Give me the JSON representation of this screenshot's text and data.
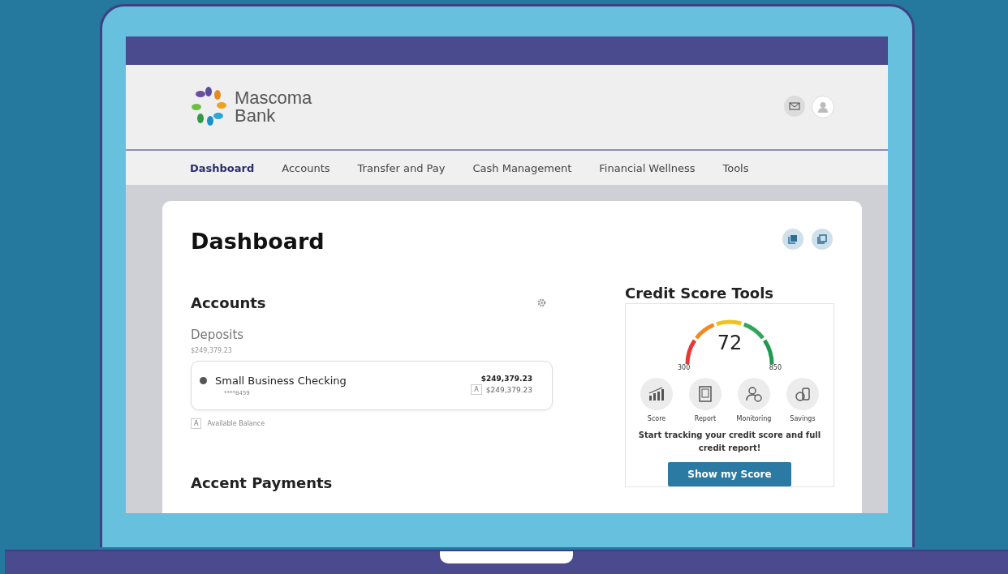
{
  "brand": {
    "line1": "Mascoma",
    "line2": "Bank"
  },
  "nav": [
    {
      "label": "Dashboard",
      "selected": true
    },
    {
      "label": "Accounts",
      "selected": false
    },
    {
      "label": "Transfer and Pay",
      "selected": false
    },
    {
      "label": "Cash Management",
      "selected": false
    },
    {
      "label": "Financial Wellness",
      "selected": false
    },
    {
      "label": "Tools",
      "selected": false
    }
  ],
  "page_title": "Dashboard",
  "accounts": {
    "title": "Accounts",
    "group": "Deposits",
    "group_total": "$249,379.23",
    "items": [
      {
        "name": "Small Business Checking",
        "number": "****8459",
        "balance": "$249,379.23",
        "available_marker": "A",
        "available": "$249,379.23"
      }
    ],
    "legend_marker": "A",
    "legend": "Available Balance"
  },
  "next_section": "Accent Payments",
  "credit": {
    "title": "Credit Score Tools",
    "score": "72",
    "min": "300",
    "max": "850",
    "tools": [
      {
        "kind": "score",
        "label": "Score"
      },
      {
        "kind": "report",
        "label": "Report"
      },
      {
        "kind": "monitoring",
        "label": "Monitoring"
      },
      {
        "kind": "savings",
        "label": "Savings"
      }
    ],
    "message": "Start tracking your credit score and full credit report!",
    "button": "Show my Score"
  }
}
